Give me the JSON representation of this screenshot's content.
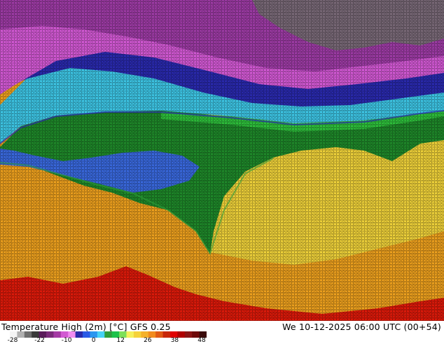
{
  "title": "Temperature High (2m) [°C] GFS 0.25",
  "valid_time": "We 10-12-2025 06:00 UTC (00+54)",
  "legend": {
    "unit": "°C",
    "ticks": [
      "-28",
      "-22",
      "-10",
      "0",
      "12",
      "26",
      "38",
      "48"
    ],
    "colors": [
      "#f4f4f4",
      "#b0b0b0",
      "#6e6e6e",
      "#3a3a3a",
      "#5a1a5a",
      "#7a2a7a",
      "#a53aa5",
      "#d25ad2",
      "#f08cf0",
      "#2a2aaa",
      "#2a5ae6",
      "#2a96f0",
      "#46d2f5",
      "#2e9e3a",
      "#1cc24a",
      "#7ee05a",
      "#f5f05a",
      "#f5d23a",
      "#f5b12a",
      "#f28c1e",
      "#e05a14",
      "#c8280a",
      "#e00000",
      "#b00000",
      "#8c1414",
      "#6e0a0a",
      "#3a0a0a"
    ]
  },
  "zones": [
    {
      "name": "arctic-gray",
      "color": "#7a6a78"
    },
    {
      "name": "purple-band",
      "color": "#a03ca8"
    },
    {
      "name": "magenta-band",
      "color": "#d65ad8"
    },
    {
      "name": "navy-band",
      "color": "#2a2ab0"
    },
    {
      "name": "blue-band",
      "color": "#3a6ae0"
    },
    {
      "name": "cyan-band",
      "color": "#3ec8e8"
    },
    {
      "name": "green-land",
      "color": "#1f8a2a"
    },
    {
      "name": "lime-band",
      "color": "#2ec23c"
    },
    {
      "name": "yellow-land",
      "color": "#f2d43a"
    },
    {
      "name": "orange-sea",
      "color": "#f0a21e"
    },
    {
      "name": "red-hot",
      "color": "#e01a0a"
    }
  ]
}
